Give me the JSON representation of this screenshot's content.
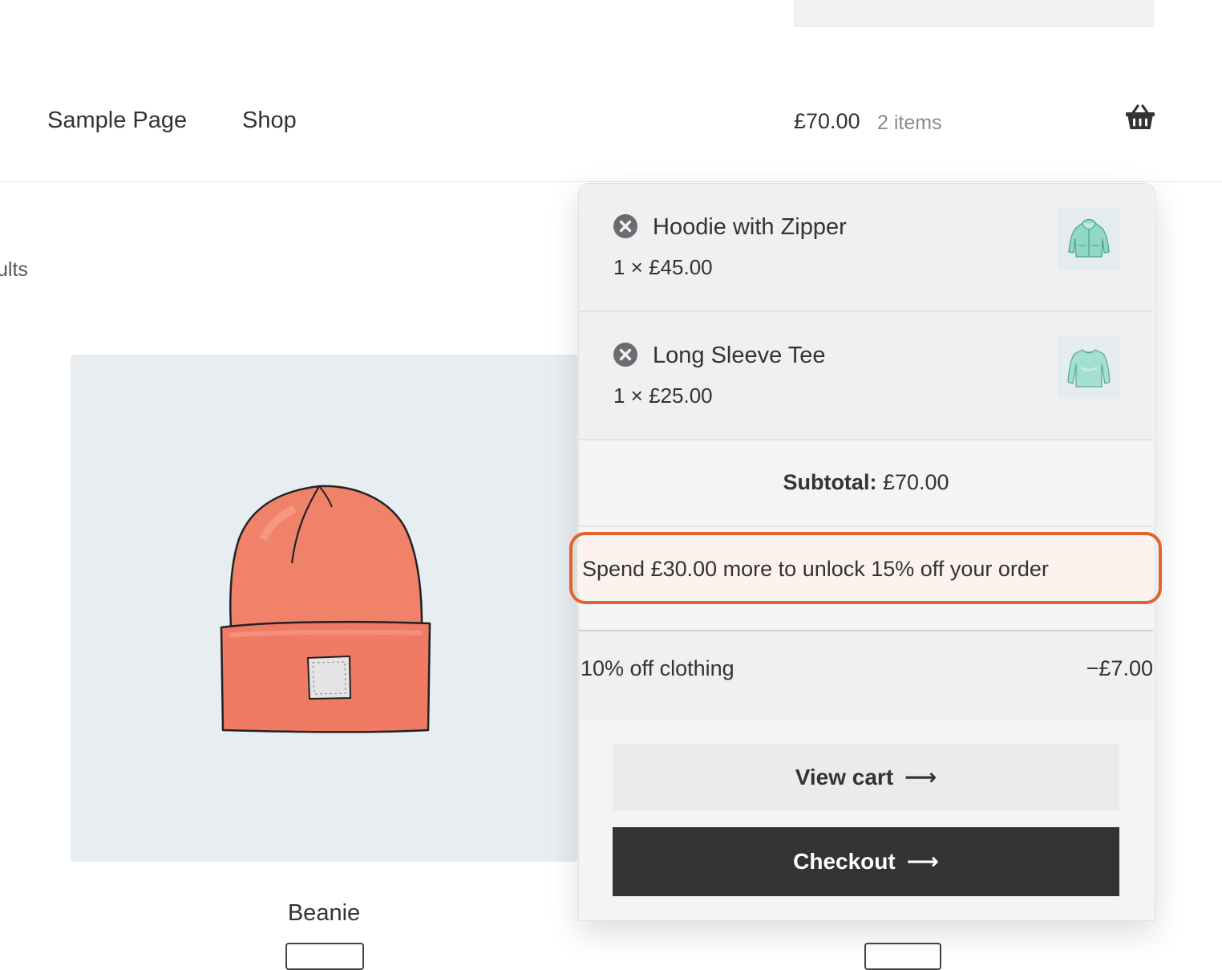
{
  "header": {
    "nav": [
      {
        "label": "Sample Page"
      },
      {
        "label": "Shop"
      }
    ],
    "cart_total": "£70.00",
    "cart_count": "2 items",
    "basket_icon": "basket-icon"
  },
  "shop": {
    "results_text": "ults",
    "products": [
      {
        "title": "Beanie"
      }
    ]
  },
  "mini_cart": {
    "items": [
      {
        "name": "Hoodie with Zipper",
        "quantity_price": "1 × £45.00",
        "remove_icon": "close-circle-icon",
        "thumb": "hoodie-image"
      },
      {
        "name": "Long Sleeve Tee",
        "quantity_price": "1 × £25.00",
        "remove_icon": "close-circle-icon",
        "thumb": "long-sleeve-tee-image"
      }
    ],
    "subtotal_label": "Subtotal:",
    "subtotal_value": "£70.00",
    "notice": "Spend £30.00 more to unlock 15% off your order",
    "discount": {
      "label": "10% off clothing",
      "value": "−£7.00"
    },
    "buttons": {
      "view_cart": "View cart",
      "checkout": "Checkout",
      "arrow": "⟶"
    }
  },
  "colors": {
    "accent": "#e5622a",
    "notice_bg": "#fdf3ee",
    "checkout_bg": "#333333",
    "product_bg": "#e8edf1"
  }
}
